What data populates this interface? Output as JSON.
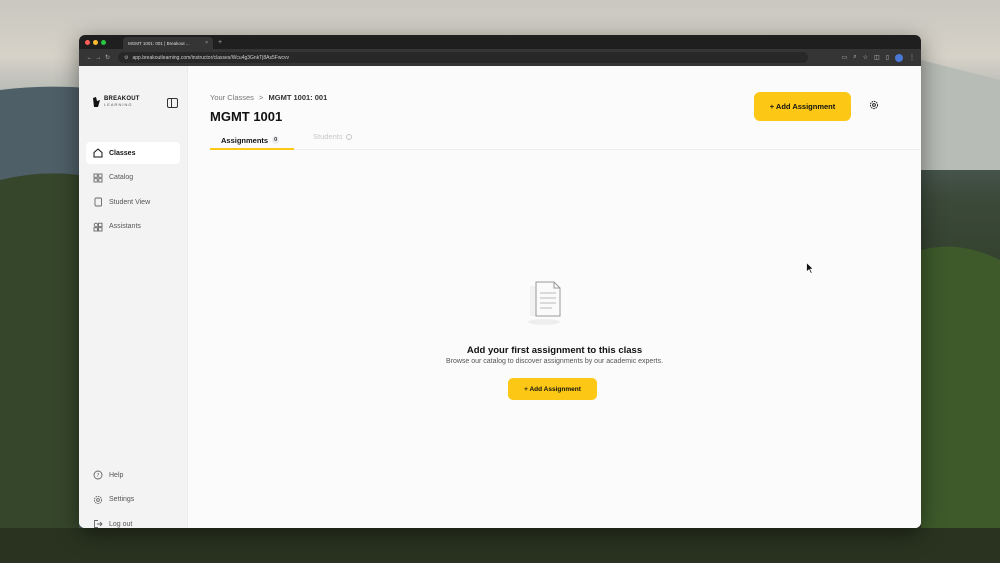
{
  "browser": {
    "tab_title": "MGMT 1001: 001 | Breakout ...",
    "url": "app.breakoutlearning.com/instructor/classes/Wcu4g3GnkTj8As5Fwcvv",
    "colors": {
      "close": "#ff5f57",
      "minimize": "#febc2e",
      "maximize": "#28c840"
    }
  },
  "logo": {
    "line1": "BREAKOUT",
    "line2": "LEARNING"
  },
  "sidebar": {
    "items": [
      {
        "label": "Classes",
        "icon": "home-icon",
        "active": true
      },
      {
        "label": "Catalog",
        "icon": "grid-icon",
        "active": false
      },
      {
        "label": "Student View",
        "icon": "document-icon",
        "active": false
      },
      {
        "label": "Assistants",
        "icon": "assistants-icon",
        "active": false
      }
    ],
    "bottom_items": [
      {
        "label": "Help",
        "icon": "help-icon"
      },
      {
        "label": "Settings",
        "icon": "gear-icon"
      },
      {
        "label": "Log out",
        "icon": "logout-icon"
      }
    ]
  },
  "header": {
    "breadcrumb_root": "Your Classes",
    "breadcrumb_sep": ">",
    "breadcrumb_current": "MGMT 1001: 001",
    "title": "MGMT 1001",
    "add_button": "+ Add Assignment"
  },
  "tabs": [
    {
      "label": "Assignments",
      "count": "0",
      "active": true
    },
    {
      "label": "Students",
      "active": false
    }
  ],
  "empty_state": {
    "title": "Add your first assignment to this class",
    "subtitle": "Browse our catalog to discover assignments by our academic experts.",
    "button": "+ Add Assignment"
  },
  "accent_color": "#fcc815"
}
